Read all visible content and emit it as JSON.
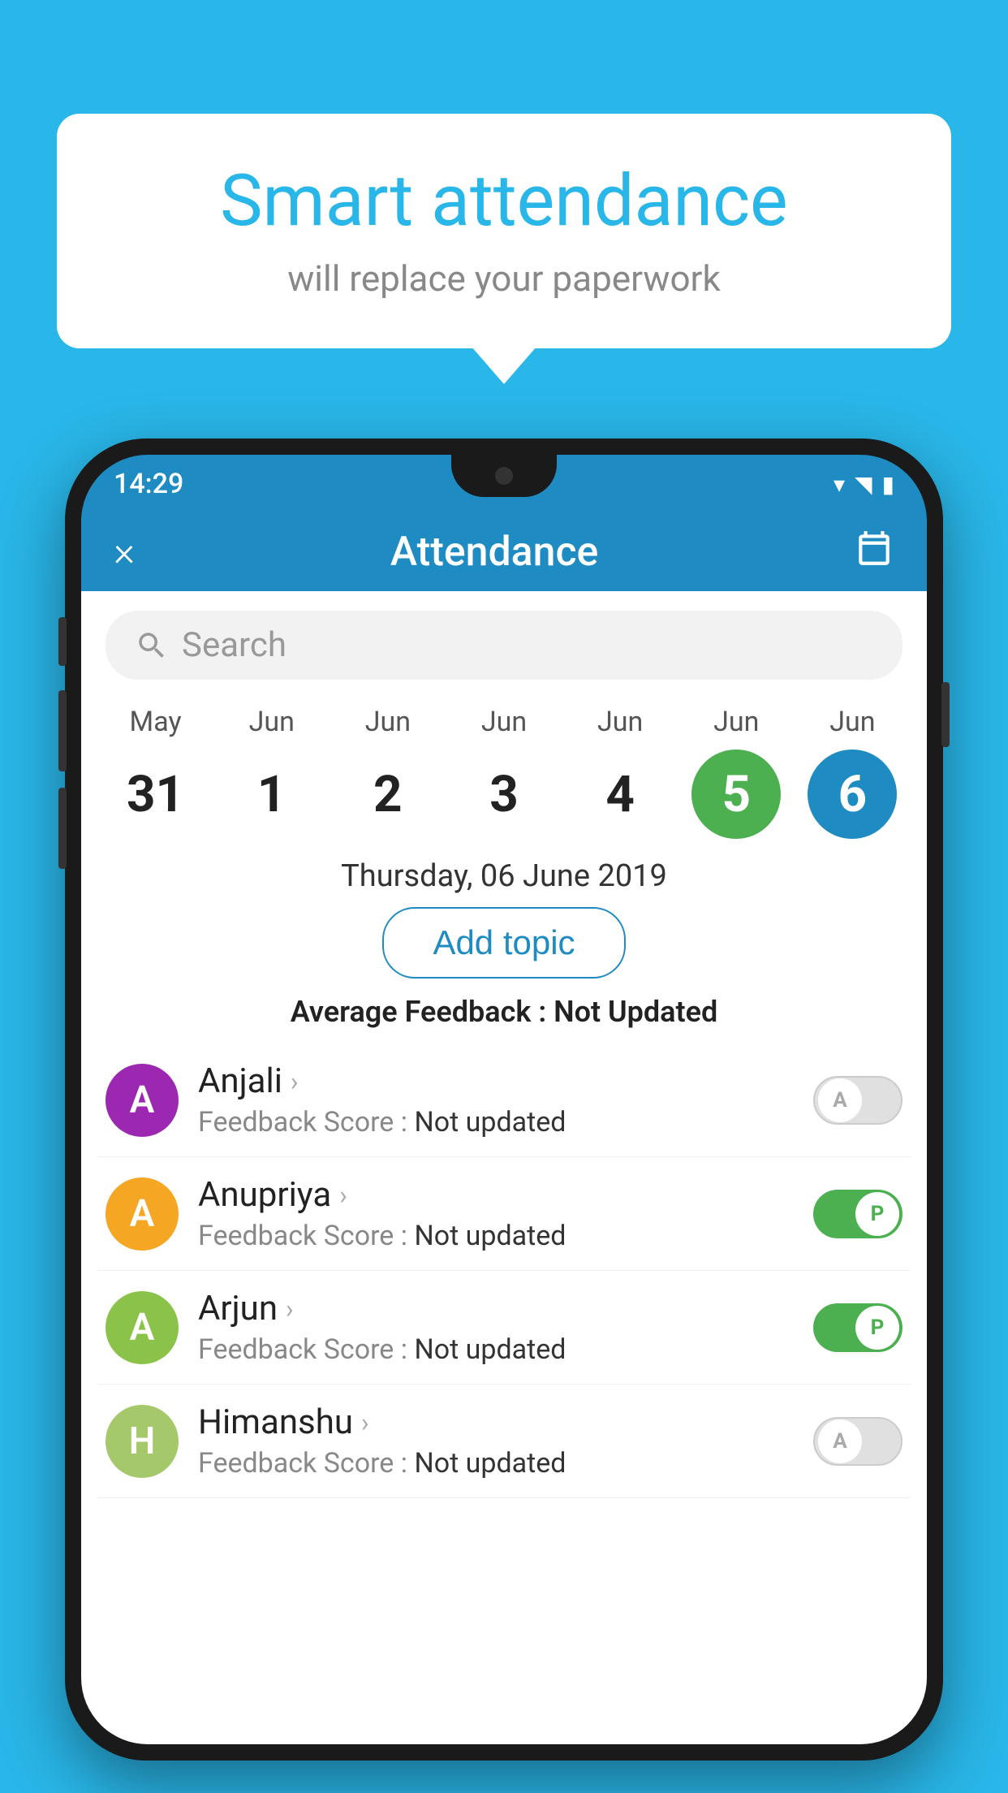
{
  "background_color": "#29b6e8",
  "speech_bubble": {
    "title": "Smart attendance",
    "subtitle": "will replace your paperwork"
  },
  "status_bar": {
    "time": "14:29",
    "wifi_icon": "▾",
    "signal_icon": "▲",
    "battery_icon": "▮"
  },
  "app_header": {
    "title": "Attendance",
    "close_label": "×",
    "calendar_icon": "📅"
  },
  "search": {
    "placeholder": "Search"
  },
  "date_picker": {
    "dates": [
      {
        "month": "May",
        "day": "31",
        "selected": false
      },
      {
        "month": "Jun",
        "day": "1",
        "selected": false
      },
      {
        "month": "Jun",
        "day": "2",
        "selected": false
      },
      {
        "month": "Jun",
        "day": "3",
        "selected": false
      },
      {
        "month": "Jun",
        "day": "4",
        "selected": false
      },
      {
        "month": "Jun",
        "day": "5",
        "selected": "green"
      },
      {
        "month": "Jun",
        "day": "6",
        "selected": "blue"
      }
    ]
  },
  "selected_date": "Thursday, 06 June 2019",
  "add_topic_label": "Add topic",
  "average_feedback": {
    "label": "Average Feedback : ",
    "value": "Not Updated"
  },
  "students": [
    {
      "name": "Anjali",
      "avatar_letter": "A",
      "avatar_color": "#9c27b0",
      "feedback_label": "Feedback Score : ",
      "feedback_value": "Not updated",
      "toggle_state": "off",
      "toggle_letter": "A"
    },
    {
      "name": "Anupriya",
      "avatar_letter": "A",
      "avatar_color": "#f5a623",
      "feedback_label": "Feedback Score : ",
      "feedback_value": "Not updated",
      "toggle_state": "on",
      "toggle_letter": "P"
    },
    {
      "name": "Arjun",
      "avatar_letter": "A",
      "avatar_color": "#8bc34a",
      "feedback_label": "Feedback Score : ",
      "feedback_value": "Not updated",
      "toggle_state": "on",
      "toggle_letter": "P"
    },
    {
      "name": "Himanshu",
      "avatar_letter": "H",
      "avatar_color": "#a5c96a",
      "feedback_label": "Feedback Score : ",
      "feedback_value": "Not updated",
      "toggle_state": "off",
      "toggle_letter": "A"
    }
  ]
}
